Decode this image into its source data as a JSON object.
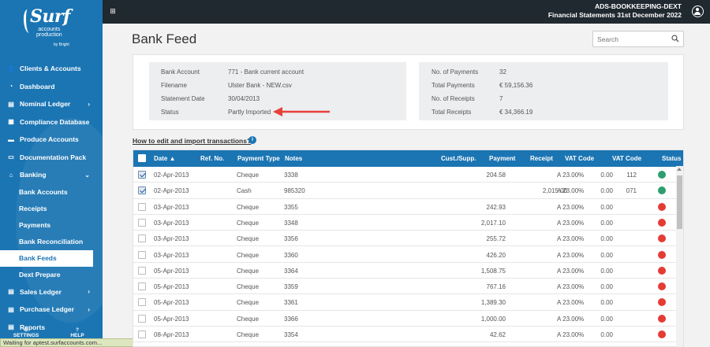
{
  "sidebar": {
    "logo": {
      "name": "Surf",
      "line1": "accounts",
      "line2": "production",
      "by": "by Bright"
    },
    "items": [
      {
        "label": "Clients & Accounts",
        "icon": "user-icon",
        "chevron": false
      },
      {
        "label": "Dashboard",
        "icon": "gauge-icon",
        "chevron": false
      },
      {
        "label": "Nominal Ledger",
        "icon": "ledger-icon",
        "chevron": true
      },
      {
        "label": "Compliance Database",
        "icon": "database-icon",
        "chevron": false
      },
      {
        "label": "Produce Accounts",
        "icon": "folder-icon",
        "chevron": false
      },
      {
        "label": "Documentation Pack",
        "icon": "folder-open-icon",
        "chevron": false
      },
      {
        "label": "Banking",
        "icon": "bank-icon",
        "chevron": true,
        "expanded": true
      }
    ],
    "banking_sub": [
      "Bank Accounts",
      "Receipts",
      "Payments",
      "Bank Reconciliation",
      "Bank Feeds",
      "Dext Prepare"
    ],
    "active_sub": "Bank Feeds",
    "items_after": [
      {
        "label": "Sales Ledger",
        "icon": "sales-icon",
        "chevron": true
      },
      {
        "label": "Purchase Ledger",
        "icon": "purchase-icon",
        "chevron": true
      },
      {
        "label": "Reports",
        "icon": "reports-icon",
        "chevron": false
      }
    ],
    "settings_label": "SETTINGS",
    "help_label": "HELP"
  },
  "statusbar": "Waiting for aptest.surfaccounts.com...",
  "topbar": {
    "org": "ADS-BOOKKEEPING-DEXT",
    "statement": "Financial Statements 31st December 2022"
  },
  "page": {
    "title": "Bank Feed",
    "search_placeholder": "Search"
  },
  "summary": {
    "left": [
      {
        "label": "Bank Account",
        "value": "771 - Bank current account"
      },
      {
        "label": "Filename",
        "value": "Ulster Bank - NEW.csv"
      },
      {
        "label": "Statement Date",
        "value": "30/04/2013"
      },
      {
        "label": "Status",
        "value": "Partly Imported"
      }
    ],
    "right": [
      {
        "label": "No. of Payments",
        "value": "32"
      },
      {
        "label": "Total Payments",
        "value": "€ 59,156.36"
      },
      {
        "label": "No. of Receipts",
        "value": "7"
      },
      {
        "label": "Total Receipts",
        "value": "€ 34,366.19"
      }
    ]
  },
  "help_link": "How to edit and import transactions?",
  "table": {
    "headers": {
      "date": "Date ▲",
      "ref": "Ref. No.",
      "ptype": "Payment Type",
      "notes": "Notes",
      "cust": "Cust./Supp.",
      "payment": "Payment",
      "receipt": "Receipt",
      "vatcode": "VAT Code",
      "vat": "VAT Code",
      "status": "Status"
    },
    "rows": [
      {
        "checked": true,
        "date": "02-Apr-2013",
        "ptype": "Cheque",
        "notes": "3338",
        "payment": "204.58",
        "receipt": "",
        "vatcode": "A 23.00%",
        "vat": "0.00",
        "ref2": "112",
        "status": "green"
      },
      {
        "checked": true,
        "date": "02-Apr-2013",
        "ptype": "Cash",
        "notes": "985320",
        "payment": "",
        "receipt": "2,015.00",
        "vatcode": "A 23.00%",
        "vat": "0.00",
        "ref2": "071",
        "status": "green"
      },
      {
        "checked": false,
        "date": "03-Apr-2013",
        "ptype": "Cheque",
        "notes": "3355",
        "payment": "242.93",
        "receipt": "",
        "vatcode": "A 23.00%",
        "vat": "0.00",
        "ref2": "",
        "status": "red"
      },
      {
        "checked": false,
        "date": "03-Apr-2013",
        "ptype": "Cheque",
        "notes": "3348",
        "payment": "2,017.10",
        "receipt": "",
        "vatcode": "A 23.00%",
        "vat": "0.00",
        "ref2": "",
        "status": "red"
      },
      {
        "checked": false,
        "date": "03-Apr-2013",
        "ptype": "Cheque",
        "notes": "3356",
        "payment": "255.72",
        "receipt": "",
        "vatcode": "A 23.00%",
        "vat": "0.00",
        "ref2": "",
        "status": "red"
      },
      {
        "checked": false,
        "date": "03-Apr-2013",
        "ptype": "Cheque",
        "notes": "3360",
        "payment": "426.20",
        "receipt": "",
        "vatcode": "A 23.00%",
        "vat": "0.00",
        "ref2": "",
        "status": "red"
      },
      {
        "checked": false,
        "date": "05-Apr-2013",
        "ptype": "Cheque",
        "notes": "3364",
        "payment": "1,508.75",
        "receipt": "",
        "vatcode": "A 23.00%",
        "vat": "0.00",
        "ref2": "",
        "status": "red"
      },
      {
        "checked": false,
        "date": "05-Apr-2013",
        "ptype": "Cheque",
        "notes": "3359",
        "payment": "767.16",
        "receipt": "",
        "vatcode": "A 23.00%",
        "vat": "0.00",
        "ref2": "",
        "status": "red"
      },
      {
        "checked": false,
        "date": "05-Apr-2013",
        "ptype": "Cheque",
        "notes": "3361",
        "payment": "1,389.30",
        "receipt": "",
        "vatcode": "A 23.00%",
        "vat": "0.00",
        "ref2": "",
        "status": "red"
      },
      {
        "checked": false,
        "date": "05-Apr-2013",
        "ptype": "Cheque",
        "notes": "3366",
        "payment": "1,000.00",
        "receipt": "",
        "vatcode": "A 23.00%",
        "vat": "0.00",
        "ref2": "",
        "status": "red"
      },
      {
        "checked": false,
        "date": "08-Apr-2013",
        "ptype": "Cheque",
        "notes": "3354",
        "payment": "42.62",
        "receipt": "",
        "vatcode": "A 23.00%",
        "vat": "0.00",
        "ref2": "",
        "status": "red"
      },
      {
        "checked": false,
        "date": "",
        "ptype": "",
        "notes": "",
        "payment": "",
        "receipt": "",
        "vatcode": "",
        "vat": "",
        "ref2": "",
        "status": "red"
      }
    ]
  },
  "colors": {
    "green": "#2e9e6f",
    "red": "#e53b35",
    "brand": "#1b75b3",
    "arrow": "#e8413c"
  }
}
